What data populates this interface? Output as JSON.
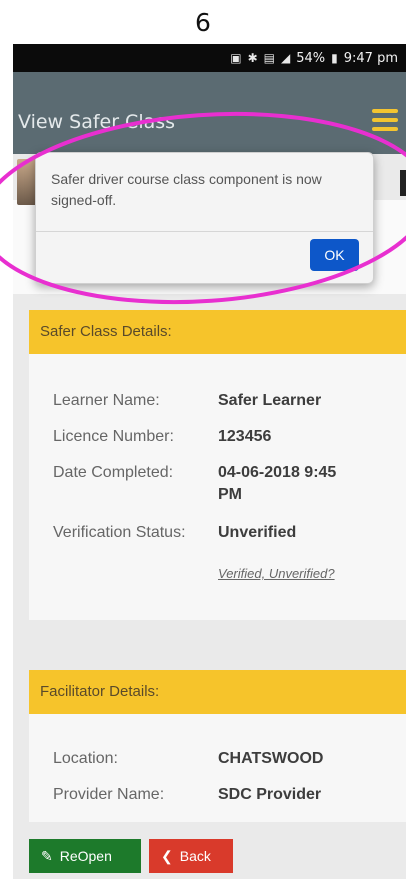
{
  "page_number": "6",
  "status_bar": {
    "battery": "54%",
    "time": "9:47 pm"
  },
  "header": {
    "title": "View Safer Class"
  },
  "dialog": {
    "message": "Safer driver course class component is now signed-off.",
    "ok_label": "OK"
  },
  "class_details": {
    "heading": "Safer Class Details:",
    "learner_name_label": "Learner Name:",
    "learner_name_value": "Safer Learner",
    "licence_label": "Licence Number:",
    "licence_value": "123456",
    "date_label": "Date Completed:",
    "date_value": "04-06-2018 9:45 PM",
    "status_label": "Verification Status:",
    "status_value": "Unverified",
    "status_help_link": "Verified, Unverified?"
  },
  "facilitator_details": {
    "heading": "Facilitator Details:",
    "location_label": "Location:",
    "location_value": "CHATSWOOD",
    "provider_label": "Provider Name:",
    "provider_value": "SDC Provider"
  },
  "actions": {
    "reopen_label": "ReOpen",
    "back_label": "Back"
  },
  "colors": {
    "header_bg": "#5b6b72",
    "accent_yellow": "#f6c42b",
    "ok_blue": "#0d57c9",
    "reopen_green": "#1d7a2b",
    "back_red": "#d93a2b",
    "annotation_magenta": "#e82fd0"
  }
}
